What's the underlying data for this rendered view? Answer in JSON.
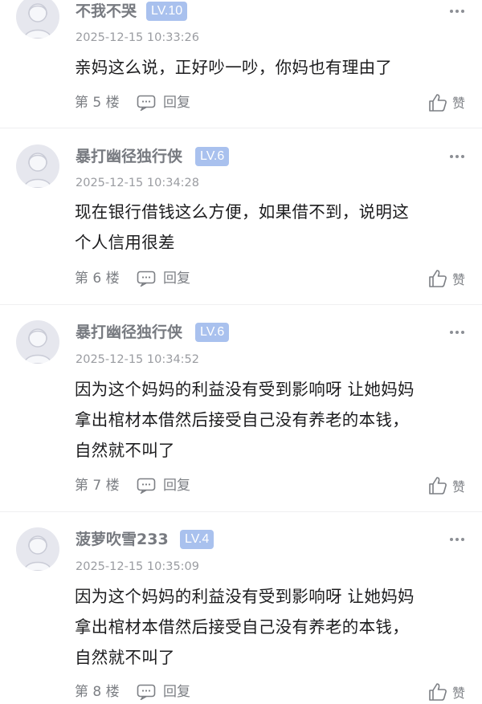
{
  "comments": [
    {
      "username": "不我不哭",
      "level": "LV.10",
      "time": "2025-12-15 10:33:26",
      "lines": [
        "亲妈这么说，正好吵一吵，你妈也有理由了"
      ],
      "floor": "第 5 楼",
      "reply_label": "回复",
      "like_label": "赞"
    },
    {
      "username": "暴打幽径独行侠",
      "level": "LV.6",
      "time": "2025-12-15 10:34:28",
      "lines": [
        "现在银行借钱这么方便，如果借不到，说明这",
        "个人信用很差"
      ],
      "floor": "第 6 楼",
      "reply_label": "回复",
      "like_label": "赞"
    },
    {
      "username": "暴打幽径独行侠",
      "level": "LV.6",
      "time": "2025-12-15 10:34:52",
      "lines": [
        "因为这个妈妈的利益没有受到影响呀 让她妈妈",
        "拿出棺材本借然后接受自己没有养老的本钱，",
        "自然就不叫了"
      ],
      "floor": "第 7 楼",
      "reply_label": "回复",
      "like_label": "赞"
    },
    {
      "username": "菠萝吹雪233",
      "level": "LV.4",
      "time": "2025-12-15 10:35:09",
      "lines": [
        "因为这个妈妈的利益没有受到影响呀 让她妈妈",
        "拿出棺材本借然后接受自己没有养老的本钱，",
        "自然就不叫了"
      ],
      "floor": "第 8 楼",
      "reply_label": "回复",
      "like_label": "赞"
    }
  ],
  "colors": {
    "level_badge": "#a9c1ee",
    "avatar_bg": "#e6e7ee",
    "text": "#1c1c1e",
    "meta": "#7c7f84"
  },
  "icons": [
    "avatar-placeholder-icon",
    "more-icon",
    "reply-icon",
    "like-icon"
  ]
}
